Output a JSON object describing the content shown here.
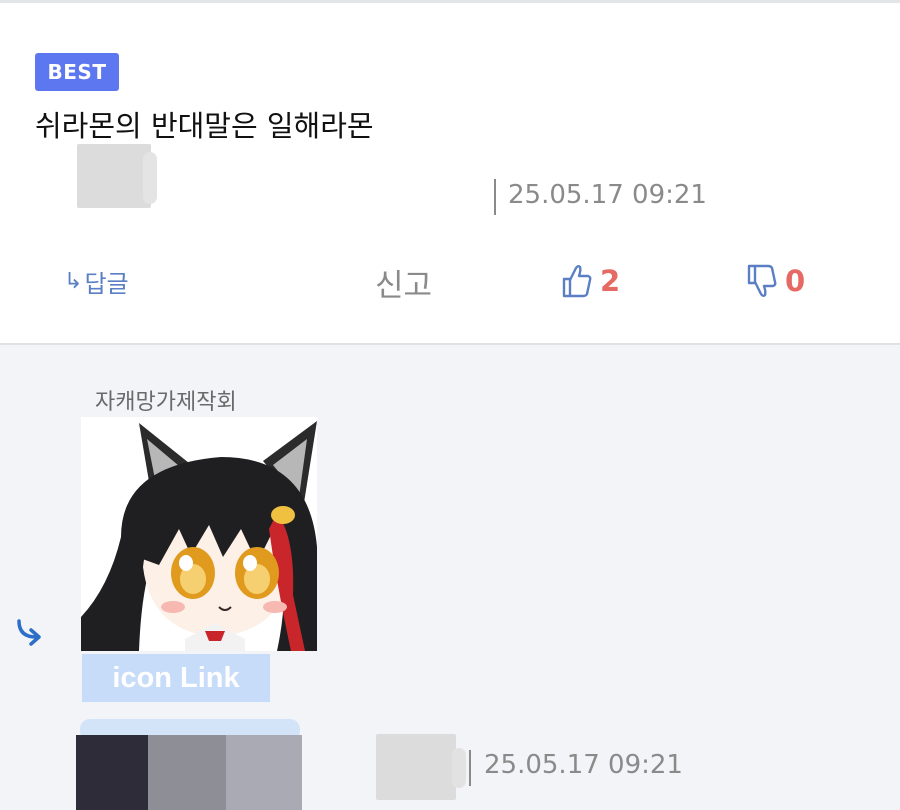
{
  "post": {
    "badge": "BEST",
    "title": "쉬라몬의 반대말은 일해라몬",
    "date": "25.05.17 09:21"
  },
  "actions": {
    "reply_label": "답글",
    "report_label": "신고",
    "like_count": "2",
    "dislike_count": "0"
  },
  "comment": {
    "author": "자캐망가제작회",
    "icon_link_label": "icon Link",
    "date": "25.05.17 09:21"
  },
  "colors": {
    "badge_bg": "#5d77f0",
    "reply_blue": "#5a7fc4",
    "vote_red": "#e46a63",
    "meta_gray": "#8a8a8a",
    "comment_bg": "#f3f4f7"
  },
  "icons": {
    "reply": "reply-arrow-icon",
    "like": "thumbs-up-icon",
    "dislike": "thumbs-down-icon",
    "comment_reply": "curved-reply-arrow-icon"
  }
}
